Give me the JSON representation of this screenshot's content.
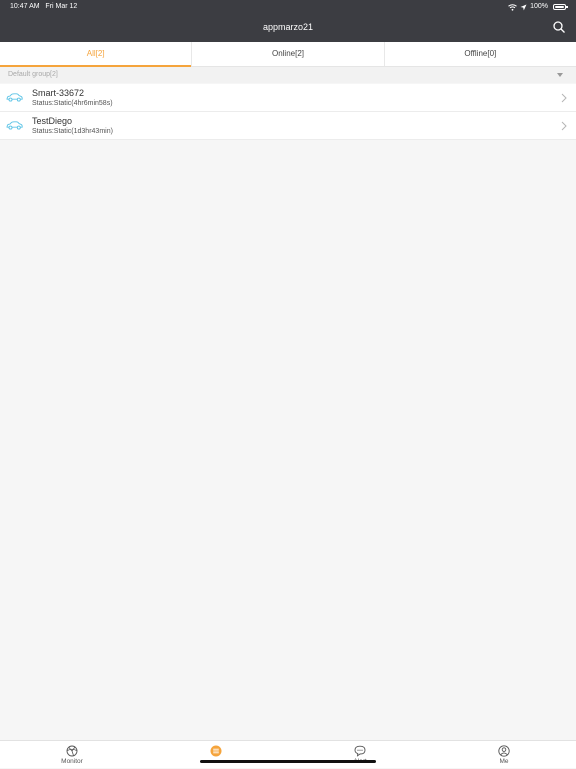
{
  "status_bar": {
    "time": "10:47 AM",
    "date": "Fri Mar 12",
    "battery": "100%",
    "icons": [
      "wifi-icon",
      "location-arrow-icon",
      "battery-icon"
    ]
  },
  "header": {
    "title": "appmarzo21",
    "search_icon": "search-icon"
  },
  "tabs": [
    {
      "label": "All[2]",
      "active": true
    },
    {
      "label": "Online[2]",
      "active": false
    },
    {
      "label": "Offline[0]",
      "active": false
    }
  ],
  "group": {
    "label": "Default group[2]"
  },
  "devices": [
    {
      "name": "Smart-33672",
      "status": "Status:Static(4hr6min58s)",
      "icon": "car-icon"
    },
    {
      "name": "TestDiego",
      "status": "Status:Static(1d3hr43min)",
      "icon": "car-icon"
    }
  ],
  "bottom_nav": [
    {
      "label": "Monitor",
      "icon": "monitor-icon",
      "active": false
    },
    {
      "label": "",
      "icon": "list-icon",
      "active": true
    },
    {
      "label": "Alert",
      "icon": "chat-icon",
      "active": false
    },
    {
      "label": "Me",
      "icon": "user-icon",
      "active": false
    }
  ],
  "colors": {
    "header_bg": "#3c3d42",
    "accent": "#f5a43c",
    "car_icon": "#5bc3e6",
    "background": "#f6f6f6"
  }
}
